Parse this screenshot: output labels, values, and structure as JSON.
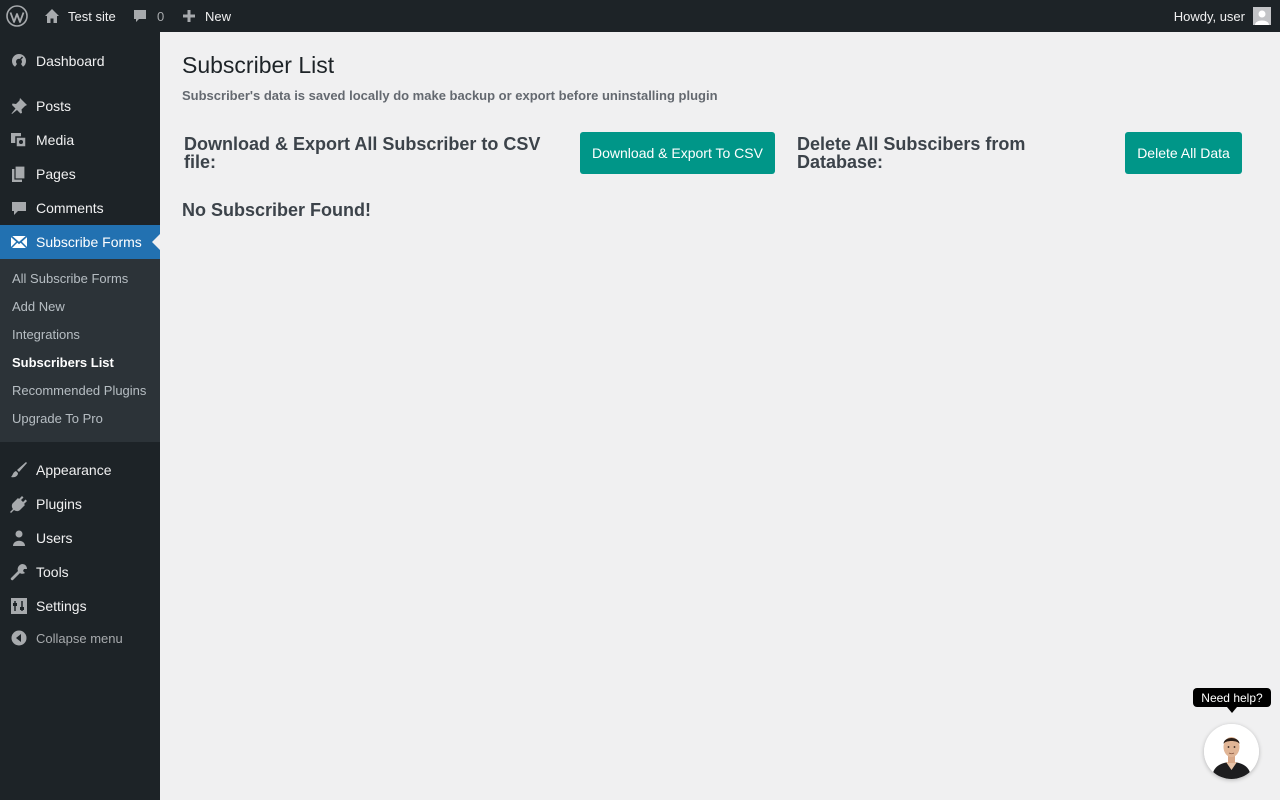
{
  "adminbar": {
    "site_name": "Test site",
    "comments_count": "0",
    "new_label": "New",
    "howdy": "Howdy, user"
  },
  "sidebar": {
    "items_top": [
      {
        "label": "Dashboard",
        "icon": "dashboard-icon"
      },
      {
        "label": "Posts",
        "icon": "pin-icon"
      },
      {
        "label": "Media",
        "icon": "media-icon"
      },
      {
        "label": "Pages",
        "icon": "pages-icon"
      },
      {
        "label": "Comments",
        "icon": "comment-icon"
      },
      {
        "label": "Subscribe Forms",
        "icon": "envelope-icon"
      }
    ],
    "submenu": [
      "All Subscribe Forms",
      "Add New",
      "Integrations",
      "Subscribers List",
      "Recommended Plugins",
      "Upgrade To Pro"
    ],
    "items_bottom": [
      {
        "label": "Appearance",
        "icon": "brush-icon"
      },
      {
        "label": "Plugins",
        "icon": "plug-icon"
      },
      {
        "label": "Users",
        "icon": "user-icon"
      },
      {
        "label": "Tools",
        "icon": "wrench-icon"
      },
      {
        "label": "Settings",
        "icon": "settings-icon"
      }
    ],
    "collapse_label": "Collapse menu"
  },
  "main": {
    "title": "Subscriber List",
    "note": "Subscriber's data is saved locally do make backup or export before uninstalling plugin",
    "export_label": "Download & Export All Subscriber to CSV file:",
    "export_button": "Download & Export To CSV",
    "delete_label": "Delete All Subscibers from Database:",
    "delete_button": "Delete All Data",
    "empty_message": "No Subscriber Found!"
  },
  "help": {
    "tooltip": "Need help?"
  },
  "colors": {
    "accent": "#2271b1",
    "button": "#009688",
    "adminbar": "#1d2327"
  }
}
